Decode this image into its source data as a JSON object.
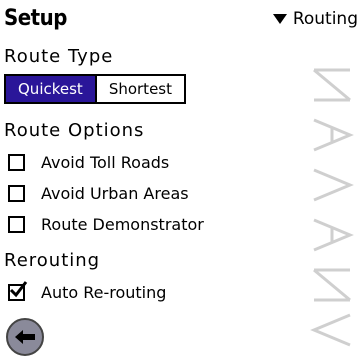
{
  "header": {
    "title": "Setup",
    "category": "Routing"
  },
  "route_type": {
    "label": "Route Type",
    "options": [
      "Quickest",
      "Shortest"
    ],
    "selected": "Quickest"
  },
  "route_options": {
    "label": "Route Options",
    "items": [
      {
        "label": "Avoid Toll Roads",
        "checked": false
      },
      {
        "label": "Avoid Urban Areas",
        "checked": false
      },
      {
        "label": "Route Demonstrator",
        "checked": false
      }
    ]
  },
  "rerouting": {
    "label": "Rerouting",
    "items": [
      {
        "label": "Auto Re-routing",
        "checked": true
      }
    ]
  },
  "colors": {
    "selected_segment": "#2a1699"
  },
  "icons": {
    "back": "left-arrow-icon",
    "menu": "triangle-down-icon"
  }
}
